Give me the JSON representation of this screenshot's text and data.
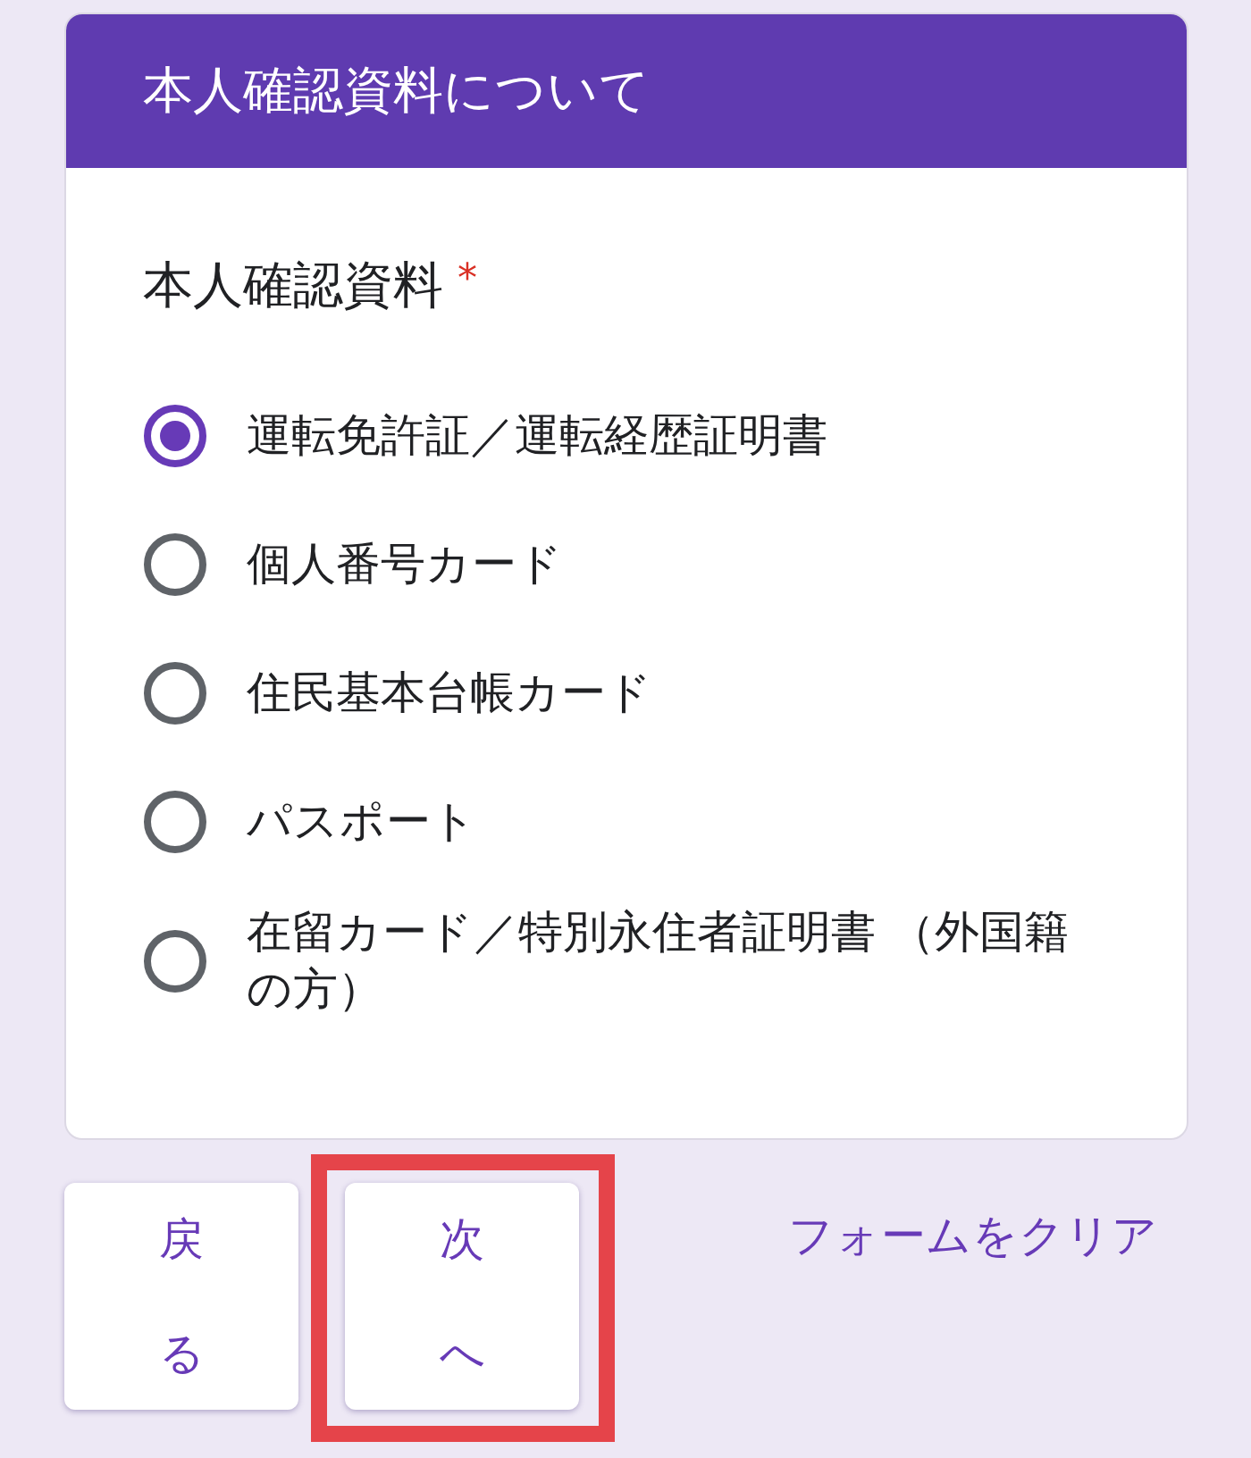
{
  "header": {
    "title": "本人確認資料について"
  },
  "question": {
    "label": "本人確認資料",
    "required_mark": "*",
    "options": [
      {
        "label": "運転免許証／運転経歴証明書",
        "selected": true
      },
      {
        "label": "個人番号カード",
        "selected": false
      },
      {
        "label": "住民基本台帳カード",
        "selected": false
      },
      {
        "label": "パスポート",
        "selected": false
      },
      {
        "label": "在留カード／特別永住者証明書 （外国籍の方）",
        "selected": false
      }
    ]
  },
  "buttons": [
    {
      "label": "戻る",
      "highlighted": false
    },
    {
      "label": "次へ",
      "highlighted": true
    }
  ],
  "clear_link": "フォームをクリア"
}
